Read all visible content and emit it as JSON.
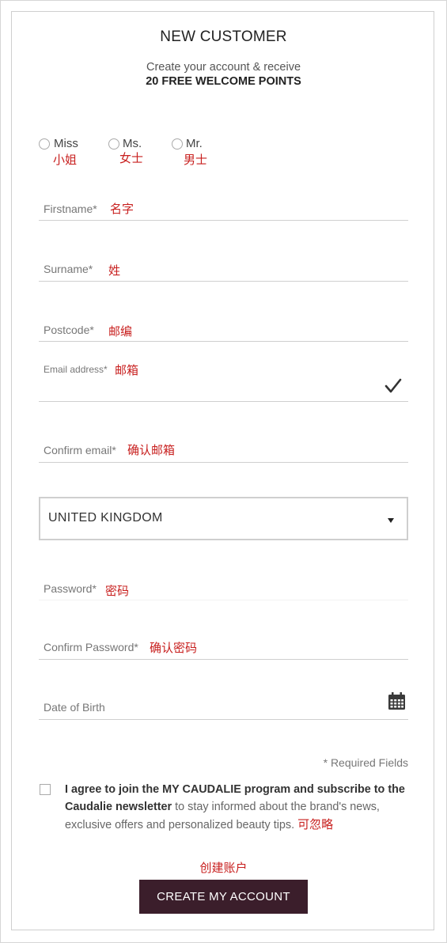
{
  "header": {
    "title": "NEW CUSTOMER",
    "subtitle_line1": "Create your account & receive",
    "subtitle_line2": "20 FREE WELCOME POINTS"
  },
  "title_options": [
    {
      "label": "Miss",
      "annotation": "小姐"
    },
    {
      "label": "Ms.",
      "annotation": "女士"
    },
    {
      "label": "Mr.",
      "annotation": "男士"
    }
  ],
  "fields": {
    "firstname": {
      "label": "Firstname*",
      "annotation": "名字"
    },
    "surname": {
      "label": "Surname*",
      "annotation": "姓"
    },
    "postcode": {
      "label": "Postcode*",
      "annotation": "邮编"
    },
    "email": {
      "label": "Email address*",
      "annotation": "邮箱"
    },
    "confirm_email": {
      "label": "Confirm email*",
      "annotation": "确认邮箱"
    },
    "country": {
      "value": "UNITED KINGDOM"
    },
    "password": {
      "label": "Password*",
      "annotation": "密码"
    },
    "confirm_password": {
      "label": "Confirm Password*",
      "annotation": "确认密码"
    },
    "dob": {
      "label": "Date of Birth"
    }
  },
  "required_note": "* Required Fields",
  "newsletter": {
    "bold_text": "I agree to join the MY CAUDALIE program and subscribe to the Caudalie newsletter",
    "rest_text": " to stay informed about the brand's news, exclusive offers and personalized beauty tips.",
    "annotation": "可忽略"
  },
  "submit": {
    "annotation": "创建账户",
    "label": "CREATE MY ACCOUNT"
  },
  "colors": {
    "button_bg": "#3b1e2b",
    "annotation_red": "#c8201f"
  }
}
